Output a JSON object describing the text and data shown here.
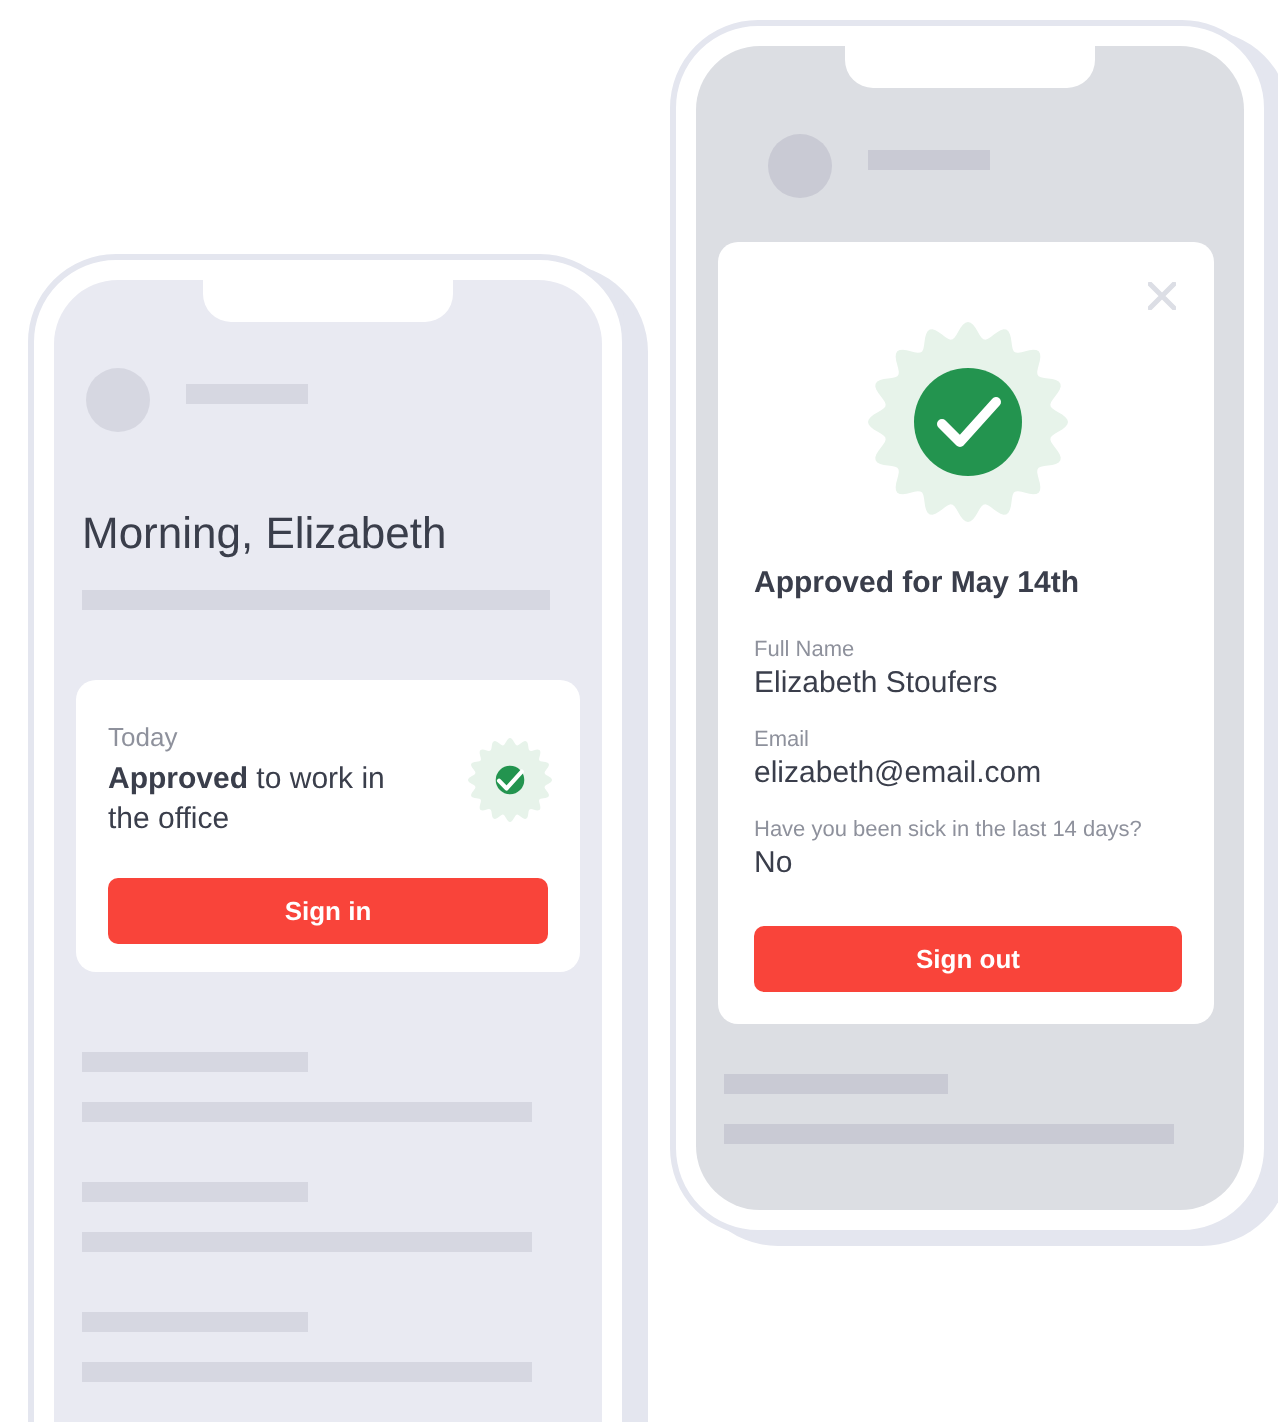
{
  "home_screen": {
    "greeting": "Morning, Elizabeth",
    "status_card": {
      "label": "Today",
      "message": "**Approved** to work in the office",
      "button": "Sign in"
    }
  },
  "approval_screen": {
    "title": "Approved for May 14th",
    "fields": [
      {
        "label": "Full Name",
        "value": "Elizabeth Stoufers"
      },
      {
        "label": "Email",
        "value": "elizabeth@email.com"
      },
      {
        "label": "Have you been sick in the last 14 days?",
        "value": "No"
      }
    ],
    "button": "Sign out"
  }
}
